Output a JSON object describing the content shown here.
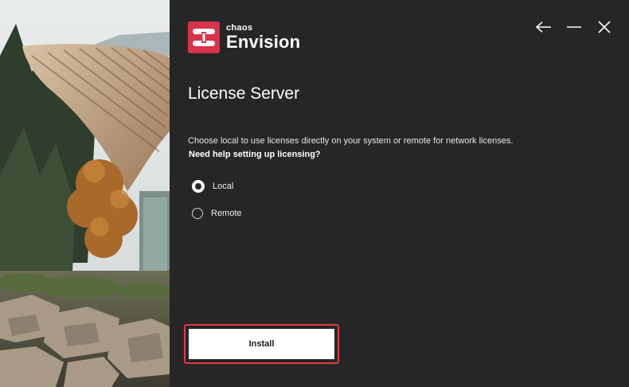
{
  "brand": {
    "company": "chaos",
    "product": "Envision",
    "accent_color": "#d8334a"
  },
  "window_controls": {
    "back_icon": "arrow-left-icon",
    "minimize_icon": "minimize-icon",
    "close_icon": "close-icon"
  },
  "page": {
    "title": "License Server",
    "description": "Choose local to use licenses directly on your system or remote for network licenses.",
    "help_link": "Need help setting up licensing?"
  },
  "options": {
    "selected": "Local",
    "items": [
      {
        "label": "Local",
        "checked": true
      },
      {
        "label": "Remote",
        "checked": false
      }
    ]
  },
  "actions": {
    "install_label": "Install",
    "highlight_color": "#e13b3b"
  }
}
